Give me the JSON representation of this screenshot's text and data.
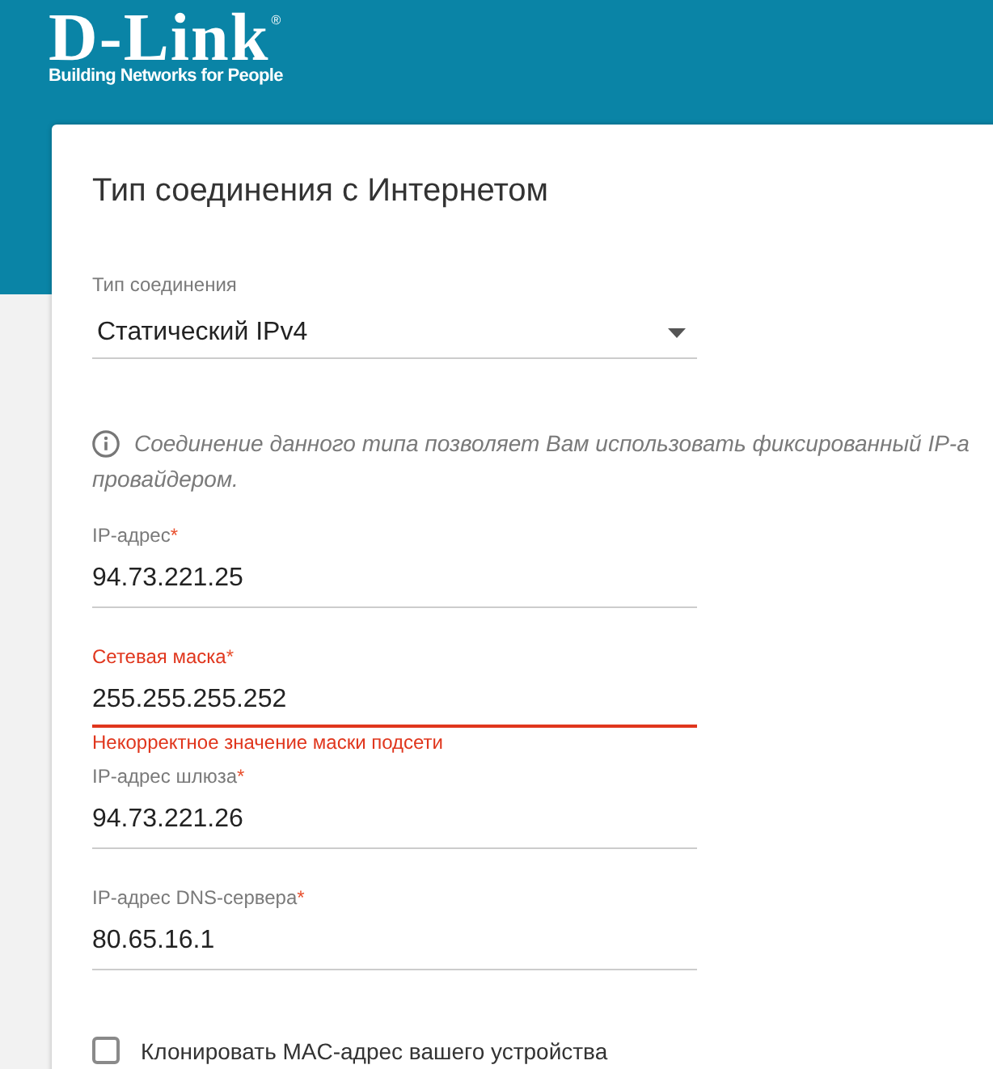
{
  "header": {
    "logo": {
      "wordmark": "D-Link",
      "registered": "®",
      "tagline": "Building Networks for People"
    }
  },
  "card": {
    "title": "Тип соединения с Интернетом",
    "connection_type": {
      "label": "Тип соединения",
      "value": "Статический IPv4"
    },
    "info": {
      "lines": [
        "Соединение данного типа позволяет Вам использовать фиксированный IP-а",
        "провайдером."
      ]
    },
    "fields": [
      {
        "label": "IP-адрес",
        "required": "*",
        "value": "94.73.221.25",
        "error": false
      },
      {
        "label": "Сетевая маска",
        "required": "*",
        "value": "255.255.255.252",
        "error": true,
        "error_message": "Некорректное значение маски подсети"
      },
      {
        "label": "IP-адрес шлюза",
        "required": "*",
        "value": "94.73.221.26",
        "error": false
      },
      {
        "label": "IP-адрес DNS-сервера",
        "required": "*",
        "value": "80.65.16.1",
        "error": false
      }
    ],
    "clone_mac": {
      "label": "Клонировать MAC-адрес вашего устройства",
      "checked": false
    }
  }
}
